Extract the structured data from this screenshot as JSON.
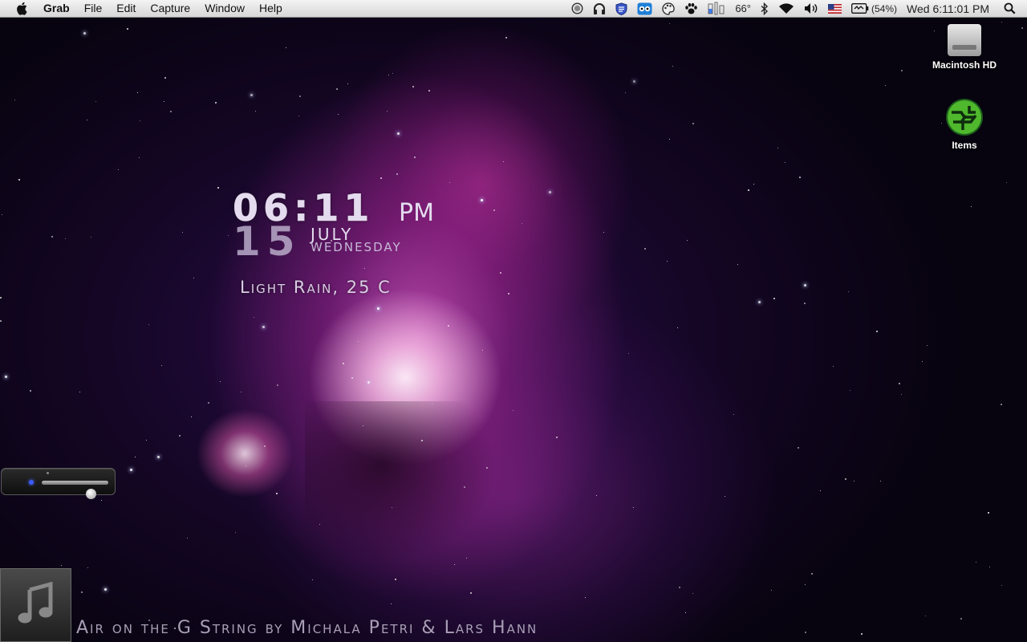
{
  "menubar": {
    "app_name": "Grab",
    "menus": [
      "File",
      "Edit",
      "Capture",
      "Window",
      "Help"
    ],
    "status_icons": [
      "clock-icon",
      "headphones-icon",
      "shield-icon",
      "owl-icon",
      "palette-icon",
      "paw-icon",
      "hardware-monitor-icon"
    ],
    "temperature": "66°",
    "battery_percent": "(54%)",
    "clock": "Wed 6:11:01 PM"
  },
  "desktop_icons": [
    {
      "label": "Macintosh HD",
      "icon": "hard-drive-icon"
    },
    {
      "label": "Items",
      "icon": "items-icon"
    }
  ],
  "clock_widget": {
    "time": "06:11",
    "ampm": "PM",
    "day": "15",
    "month": "July",
    "weekday": "Wednesday",
    "weather": "Light Rain, 25 C"
  },
  "volume_widget": {
    "level": 0.73
  },
  "now_playing": {
    "text": "Air on the G String by Michala Petri & Lars Hann"
  }
}
